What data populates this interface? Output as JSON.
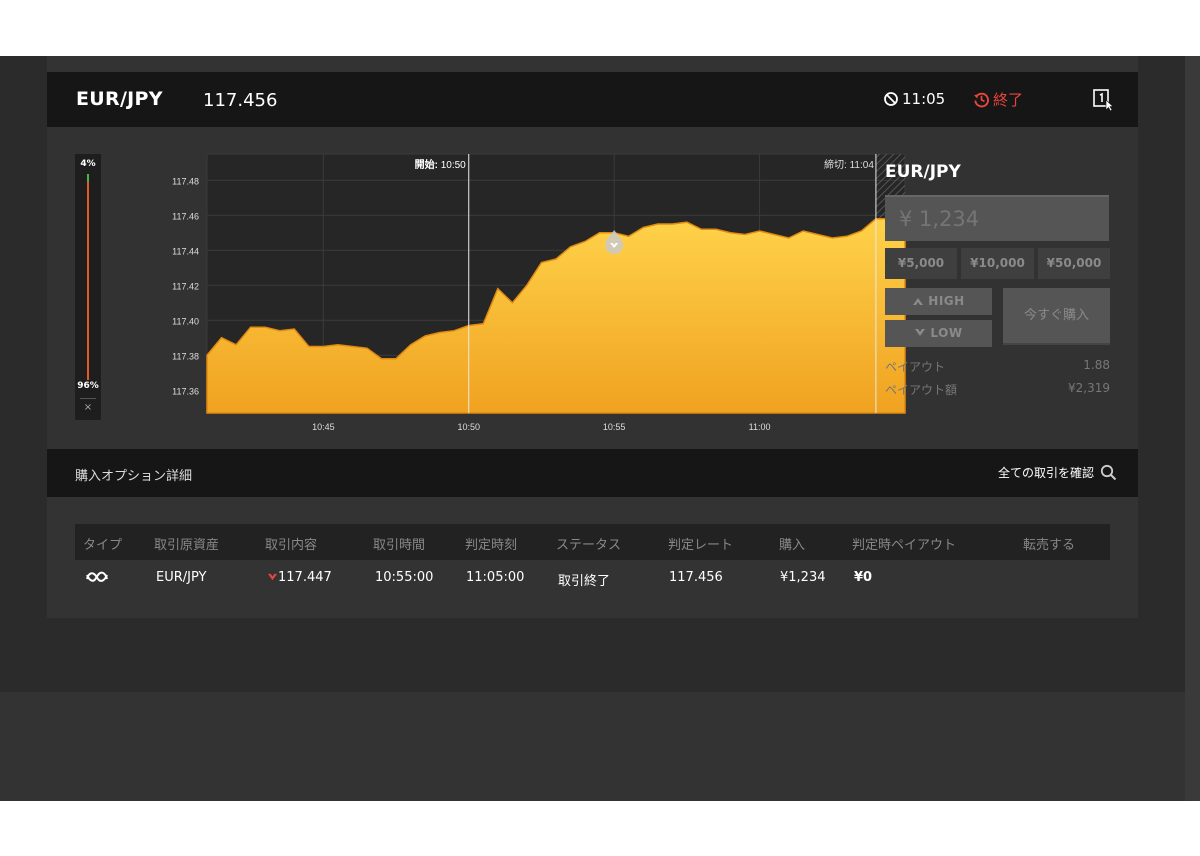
{
  "header": {
    "pair": "EUR/JPY",
    "rate": "117.456",
    "expiry_time": "11:05",
    "status": "終了"
  },
  "chart_data": {
    "type": "area",
    "y_ticks": [
      "117.48",
      "117.46",
      "117.44",
      "117.42",
      "117.40",
      "117.38",
      "117.36"
    ],
    "x_ticks": [
      "10:45",
      "10:50",
      "10:55",
      "11:00"
    ],
    "start_label": "開始:",
    "start_time": "10:50",
    "close_label": "締切:",
    "close_time": "11:04",
    "ylim": [
      117.347,
      117.495
    ],
    "xlim": [
      "10:41",
      "11:05"
    ],
    "x": [
      "10:41",
      "10:41:30",
      "10:42",
      "10:42:30",
      "10:43",
      "10:43:30",
      "10:44",
      "10:44:30",
      "10:45",
      "10:45:30",
      "10:46",
      "10:46:30",
      "10:47",
      "10:47:30",
      "10:48",
      "10:48:30",
      "10:49",
      "10:49:30",
      "10:50",
      "10:50:30",
      "10:51",
      "10:51:30",
      "10:52",
      "10:52:30",
      "10:53",
      "10:53:30",
      "10:54",
      "10:54:30",
      "10:55",
      "10:55:30",
      "10:56",
      "10:56:30",
      "10:57",
      "10:57:30",
      "10:58",
      "10:58:30",
      "10:59",
      "10:59:30",
      "11:00",
      "11:00:30",
      "11:01",
      "11:01:30",
      "11:02",
      "11:02:30",
      "11:03",
      "11:03:30",
      "11:04",
      "11:04:30",
      "11:05"
    ],
    "values": [
      117.38,
      117.39,
      117.386,
      117.396,
      117.396,
      117.394,
      117.395,
      117.385,
      117.385,
      117.386,
      117.385,
      117.384,
      117.378,
      117.378,
      117.386,
      117.391,
      117.393,
      117.394,
      117.397,
      117.398,
      117.418,
      117.41,
      117.42,
      117.433,
      117.435,
      117.442,
      117.445,
      117.45,
      117.45,
      117.448,
      117.453,
      117.455,
      117.455,
      117.456,
      117.452,
      117.452,
      117.45,
      117.449,
      117.451,
      117.449,
      117.447,
      117.451,
      117.449,
      117.447,
      117.448,
      117.451,
      117.458,
      117.458,
      117.457
    ],
    "color": "#f7b928",
    "rate_colors": {
      "rising": "#ffd24a",
      "falling": "#f0a220",
      "edge": "#e08a10"
    }
  },
  "ratio": {
    "high_pct": "4%",
    "low_pct": "96%",
    "close_label": "×"
  },
  "order": {
    "pair": "EUR/JPY",
    "amount_placeholder": "¥ 1,234",
    "quick_amounts": [
      "¥5,000",
      "¥10,000",
      "¥50,000"
    ],
    "high_label": "HIGH",
    "low_label": "LOW",
    "buy_now_label": "今すぐ購入",
    "payout_label": "ペイアウト",
    "payout_value": "1.88",
    "payout_amount_label": "ペイアウト額",
    "payout_amount_value": "¥2,319"
  },
  "details": {
    "title": "購入オプション詳細",
    "confirm_all": "全ての取引を確認",
    "columns": [
      "タイプ",
      "取引原資産",
      "取引内容",
      "取引時間",
      "判定時刻",
      "ステータス",
      "判定レート",
      "購入",
      "判定時ペイアウト",
      "転売する"
    ],
    "row": {
      "asset": "EUR/JPY",
      "content": "117.447",
      "trade_time": "10:55:00",
      "judge_time": "11:05:00",
      "status": "取引終了",
      "judge_rate": "117.456",
      "purchase": "¥1,234",
      "payout": "¥0"
    }
  },
  "colors": {
    "accent_red": "#e8453c",
    "chart_fill": "#f7b928",
    "panel": "#333333",
    "bar": "#161616"
  },
  "icons": [
    "stopwatch-icon",
    "history-icon",
    "window-icon",
    "high-arrow-icon",
    "low-arrow-icon",
    "search-icon",
    "highlow-type-icon"
  ]
}
